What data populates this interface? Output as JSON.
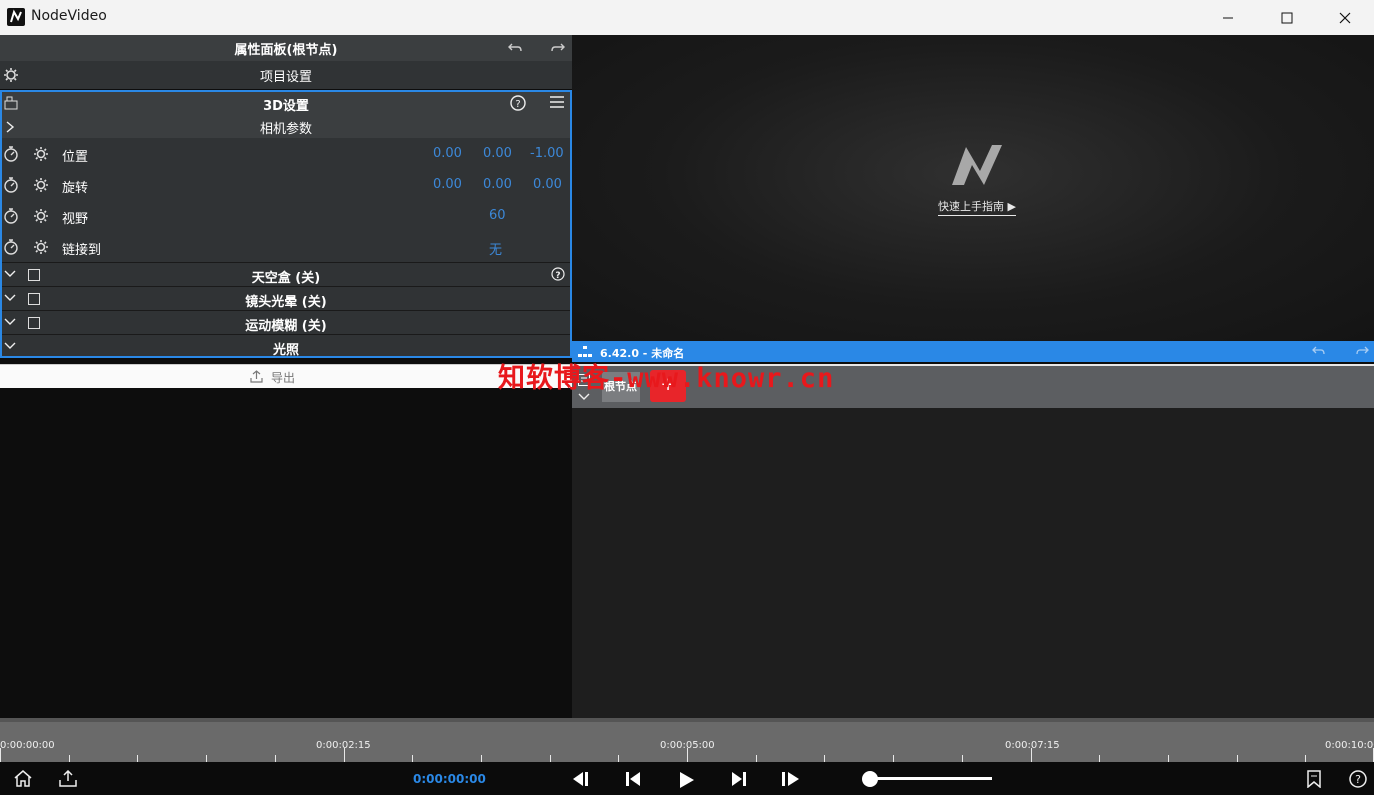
{
  "window": {
    "title": "NodeVideo"
  },
  "properties": {
    "title": "属性面板(根节点)",
    "project_settings": "项目设置",
    "section_3d": "3D设置",
    "camera_params": "相机参数",
    "rows": [
      {
        "label": "位置",
        "values": [
          "0.00",
          "0.00",
          "-1.00"
        ]
      },
      {
        "label": "旋转",
        "values": [
          "0.00",
          "0.00",
          "0.00"
        ]
      },
      {
        "label": "视野",
        "values": [
          "60"
        ]
      },
      {
        "label": "链接到",
        "values": [
          "无"
        ]
      }
    ],
    "skybox": "天空盒 (关)",
    "lens_flare": "镜头光晕 (关)",
    "motion_blur": "运动模糊 (关)",
    "lighting": "光照",
    "export": "导出"
  },
  "preview": {
    "guide_link": "快速上手指南"
  },
  "node_bar": {
    "label": "6.42.0 - 未命名"
  },
  "node_graph": {
    "root_node": "根节点",
    "add": "+"
  },
  "timeline": {
    "labels": [
      "0:00:00:00",
      "0:00:02:15",
      "0:00:05:00",
      "0:00:07:15",
      "0:00:10:00"
    ],
    "current_time": "0:00:00:00",
    "playback_position": 0.0
  },
  "watermark": "知软博客-www.knowr.cn",
  "colors": {
    "accent": "#2a88e6",
    "value_text": "#3c88d8",
    "add_button": "#e8252a"
  }
}
